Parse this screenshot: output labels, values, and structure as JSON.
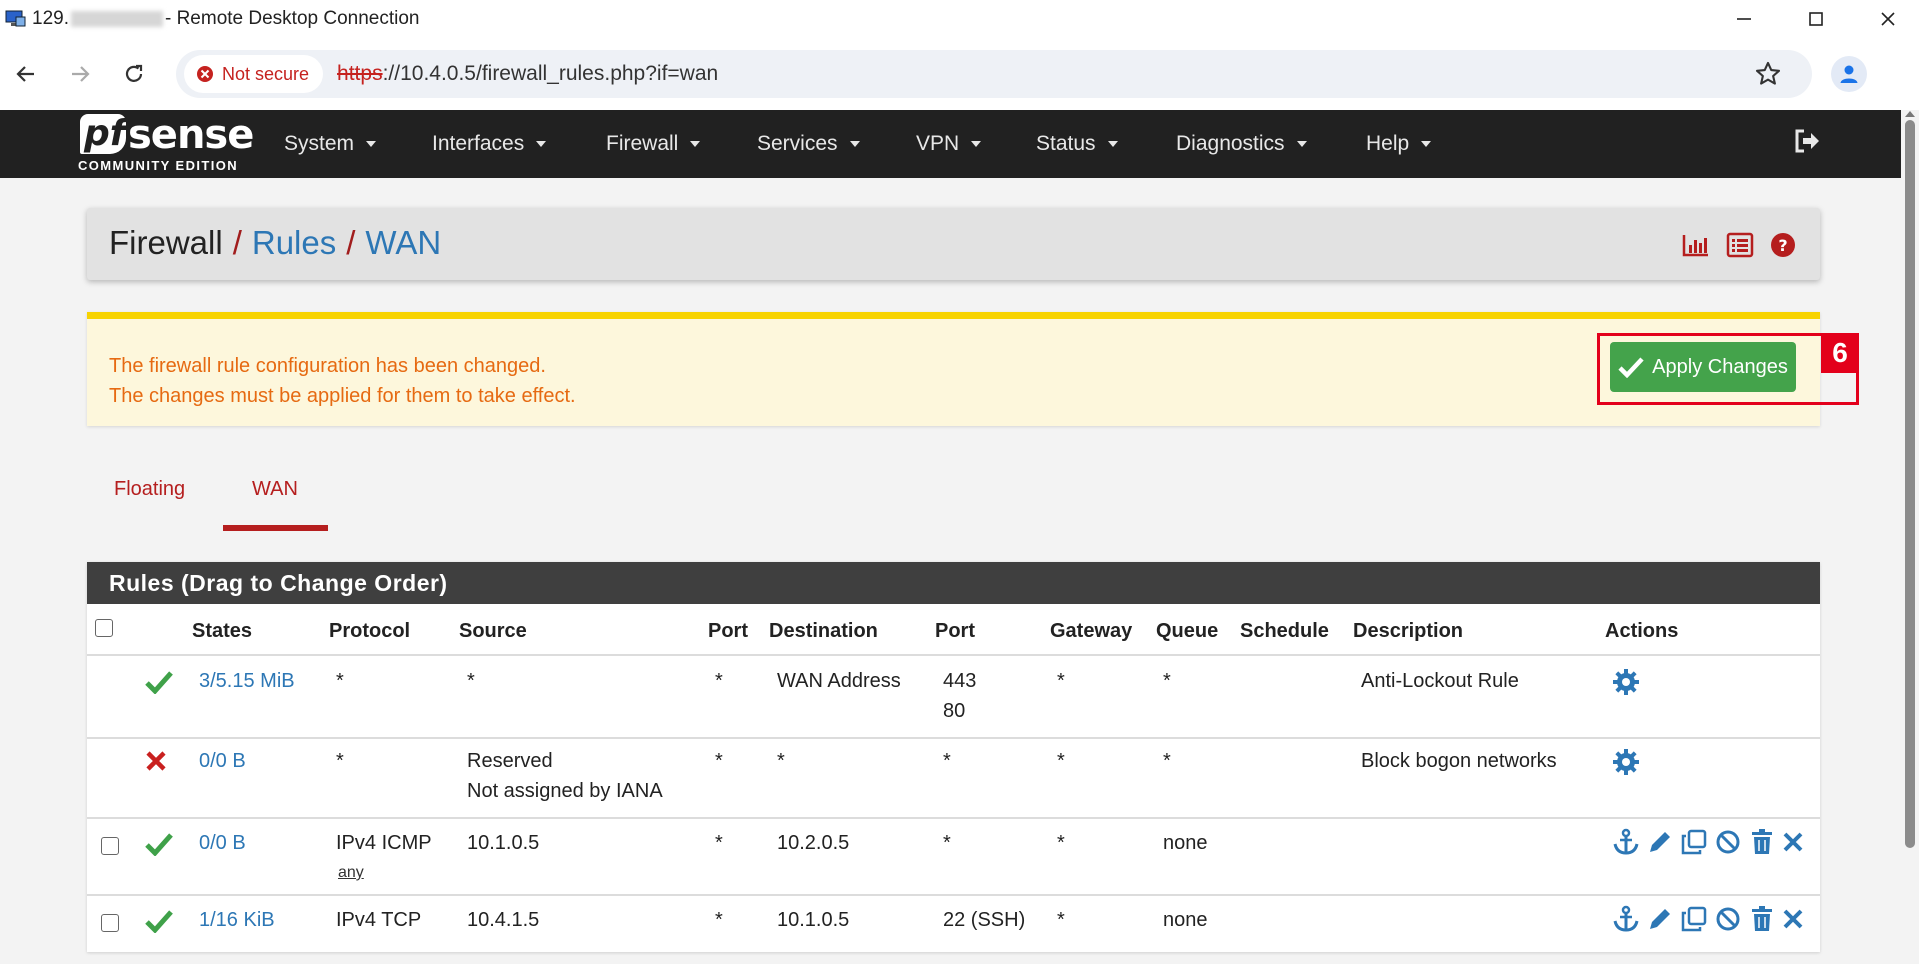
{
  "window": {
    "title_prefix": "129.",
    "title_suffix": "- Remote Desktop Connection"
  },
  "browser": {
    "security_label": "Not secure",
    "url_scheme": "https",
    "url_rest": "://10.4.0.5/firewall_rules.php?if=wan"
  },
  "nav": {
    "brand_sub": "COMMUNITY EDITION",
    "items": [
      "System",
      "Interfaces",
      "Firewall",
      "Services",
      "VPN",
      "Status",
      "Diagnostics",
      "Help"
    ]
  },
  "breadcrumb": {
    "root": "Firewall",
    "sep": "/",
    "level2": "Rules",
    "level3": "WAN"
  },
  "alert": {
    "line1": "The firewall rule configuration has been changed.",
    "line2": "The changes must be applied for them to take effect.",
    "apply_label": "Apply Changes",
    "annotation_number": "6"
  },
  "tabs": [
    "Floating",
    "WAN"
  ],
  "rules": {
    "title": "Rules (Drag to Change Order)",
    "columns": [
      "States",
      "Protocol",
      "Source",
      "Port",
      "Destination",
      "Port",
      "Gateway",
      "Queue",
      "Schedule",
      "Description",
      "Actions"
    ],
    "rows": [
      {
        "status": "pass",
        "states": "3/5.15 MiB",
        "protocol": "*",
        "protocol_sub": "",
        "source": "*",
        "source_sub": "",
        "sport": "*",
        "destination": "WAN Address",
        "dport": "443",
        "dport_sub": "80",
        "gateway": "*",
        "queue": "*",
        "schedule": "",
        "description": "Anti-Lockout Rule"
      },
      {
        "status": "block",
        "states": "0/0 B",
        "protocol": "*",
        "protocol_sub": "",
        "source": "Reserved",
        "source_sub": "Not assigned by IANA",
        "sport": "*",
        "destination": "*",
        "dport": "*",
        "dport_sub": "",
        "gateway": "*",
        "queue": "*",
        "schedule": "",
        "description": "Block bogon networks"
      },
      {
        "status": "pass",
        "states": "0/0 B",
        "protocol": "IPv4 ICMP",
        "protocol_sub": "any",
        "source": "10.1.0.5",
        "source_sub": "",
        "sport": "*",
        "destination": "10.2.0.5",
        "dport": "*",
        "dport_sub": "",
        "gateway": "*",
        "queue": "none",
        "schedule": "",
        "description": ""
      },
      {
        "status": "pass",
        "states": "1/16 KiB",
        "protocol": "IPv4 TCP",
        "protocol_sub": "",
        "source": "10.4.1.5",
        "source_sub": "",
        "sport": "*",
        "destination": "10.1.0.5",
        "dport": "22 (SSH)",
        "dport_sub": "",
        "gateway": "*",
        "queue": "none",
        "schedule": "",
        "description": ""
      }
    ]
  },
  "colors": {
    "pass": "#3fa149",
    "block": "#c9201f",
    "link": "#2d77b5",
    "accent": "#b51e1e"
  }
}
